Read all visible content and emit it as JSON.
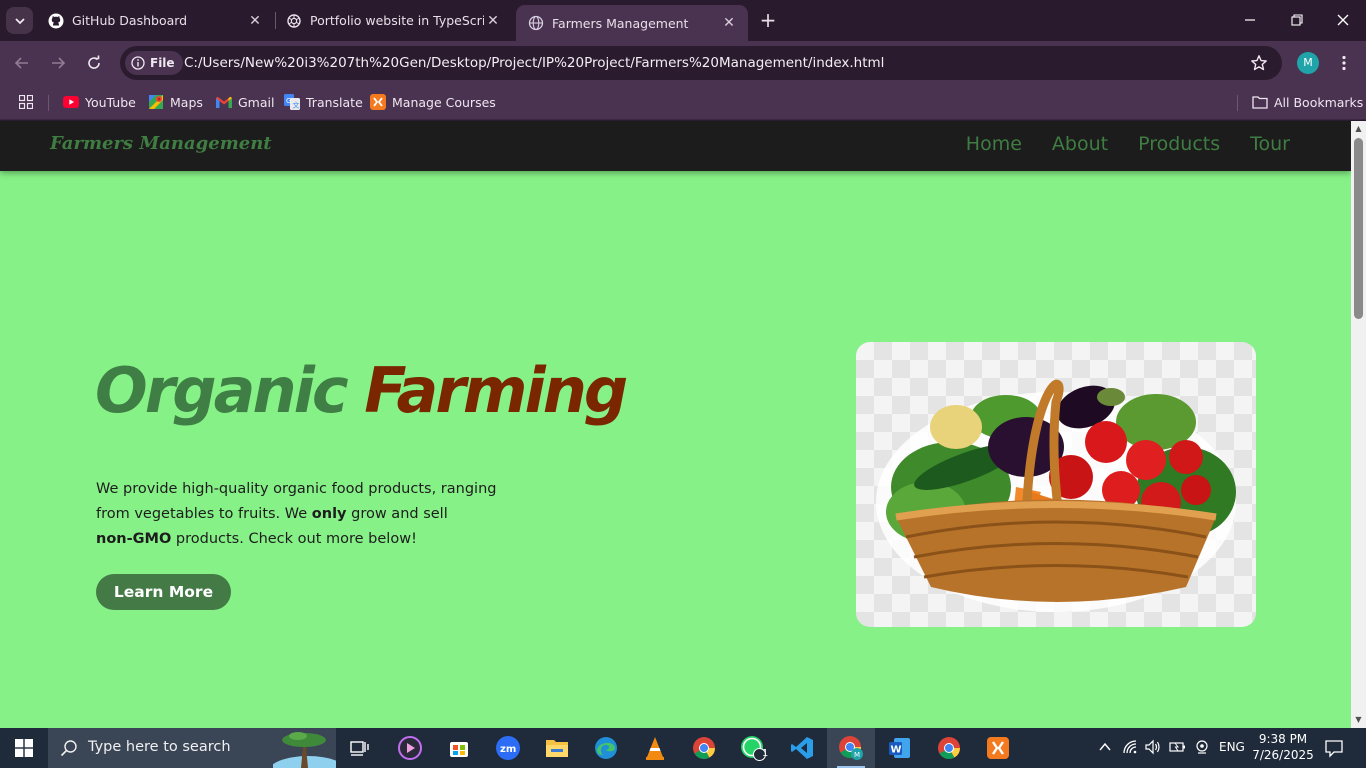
{
  "browser": {
    "tabs": [
      {
        "title": "GitHub Dashboard",
        "icon": "github-icon",
        "active": false
      },
      {
        "title": "Portfolio website in TypeScript",
        "icon": "chatgpt-icon",
        "active": false
      },
      {
        "title": "Farmers Management",
        "icon": "globe-icon",
        "active": true
      }
    ],
    "address_chip": "File",
    "url": "C:/Users/New%20i3%207th%20Gen/Desktop/Project/IP%20Project/Farmers%20Management/index.html",
    "profile_initial": "M",
    "bookmarks": [
      {
        "label": "YouTube",
        "icon": "youtube-icon"
      },
      {
        "label": "Maps",
        "icon": "maps-icon"
      },
      {
        "label": "Gmail",
        "icon": "gmail-icon"
      },
      {
        "label": "Translate",
        "icon": "translate-icon"
      },
      {
        "label": "Manage Courses",
        "icon": "xampp-icon"
      }
    ],
    "all_bookmarks": "All Bookmarks"
  },
  "site": {
    "brand": "Farmers Management",
    "nav": [
      "Home",
      "About",
      "Products",
      "Tour"
    ],
    "hero": {
      "title_part1": "Organic",
      "title_part2": "Farming",
      "text_1": "We provide high-quality organic food products, ranging from vegetables to fruits. We ",
      "text_bold_1": "only",
      "text_2": " grow and sell ",
      "text_bold_2": "non-GMO",
      "text_3": " products. Check out more below!",
      "button": "Learn More"
    },
    "colors": {
      "background": "#86f187",
      "navbar": "#1c1c1c",
      "accent_green": "#3f7e45",
      "accent_brown": "#7a2600"
    }
  },
  "taskbar": {
    "search_placeholder": "Type here to search",
    "whatsapp_badge": "1",
    "language": "ENG",
    "time": "9:38 PM",
    "date": "7/26/2025"
  }
}
